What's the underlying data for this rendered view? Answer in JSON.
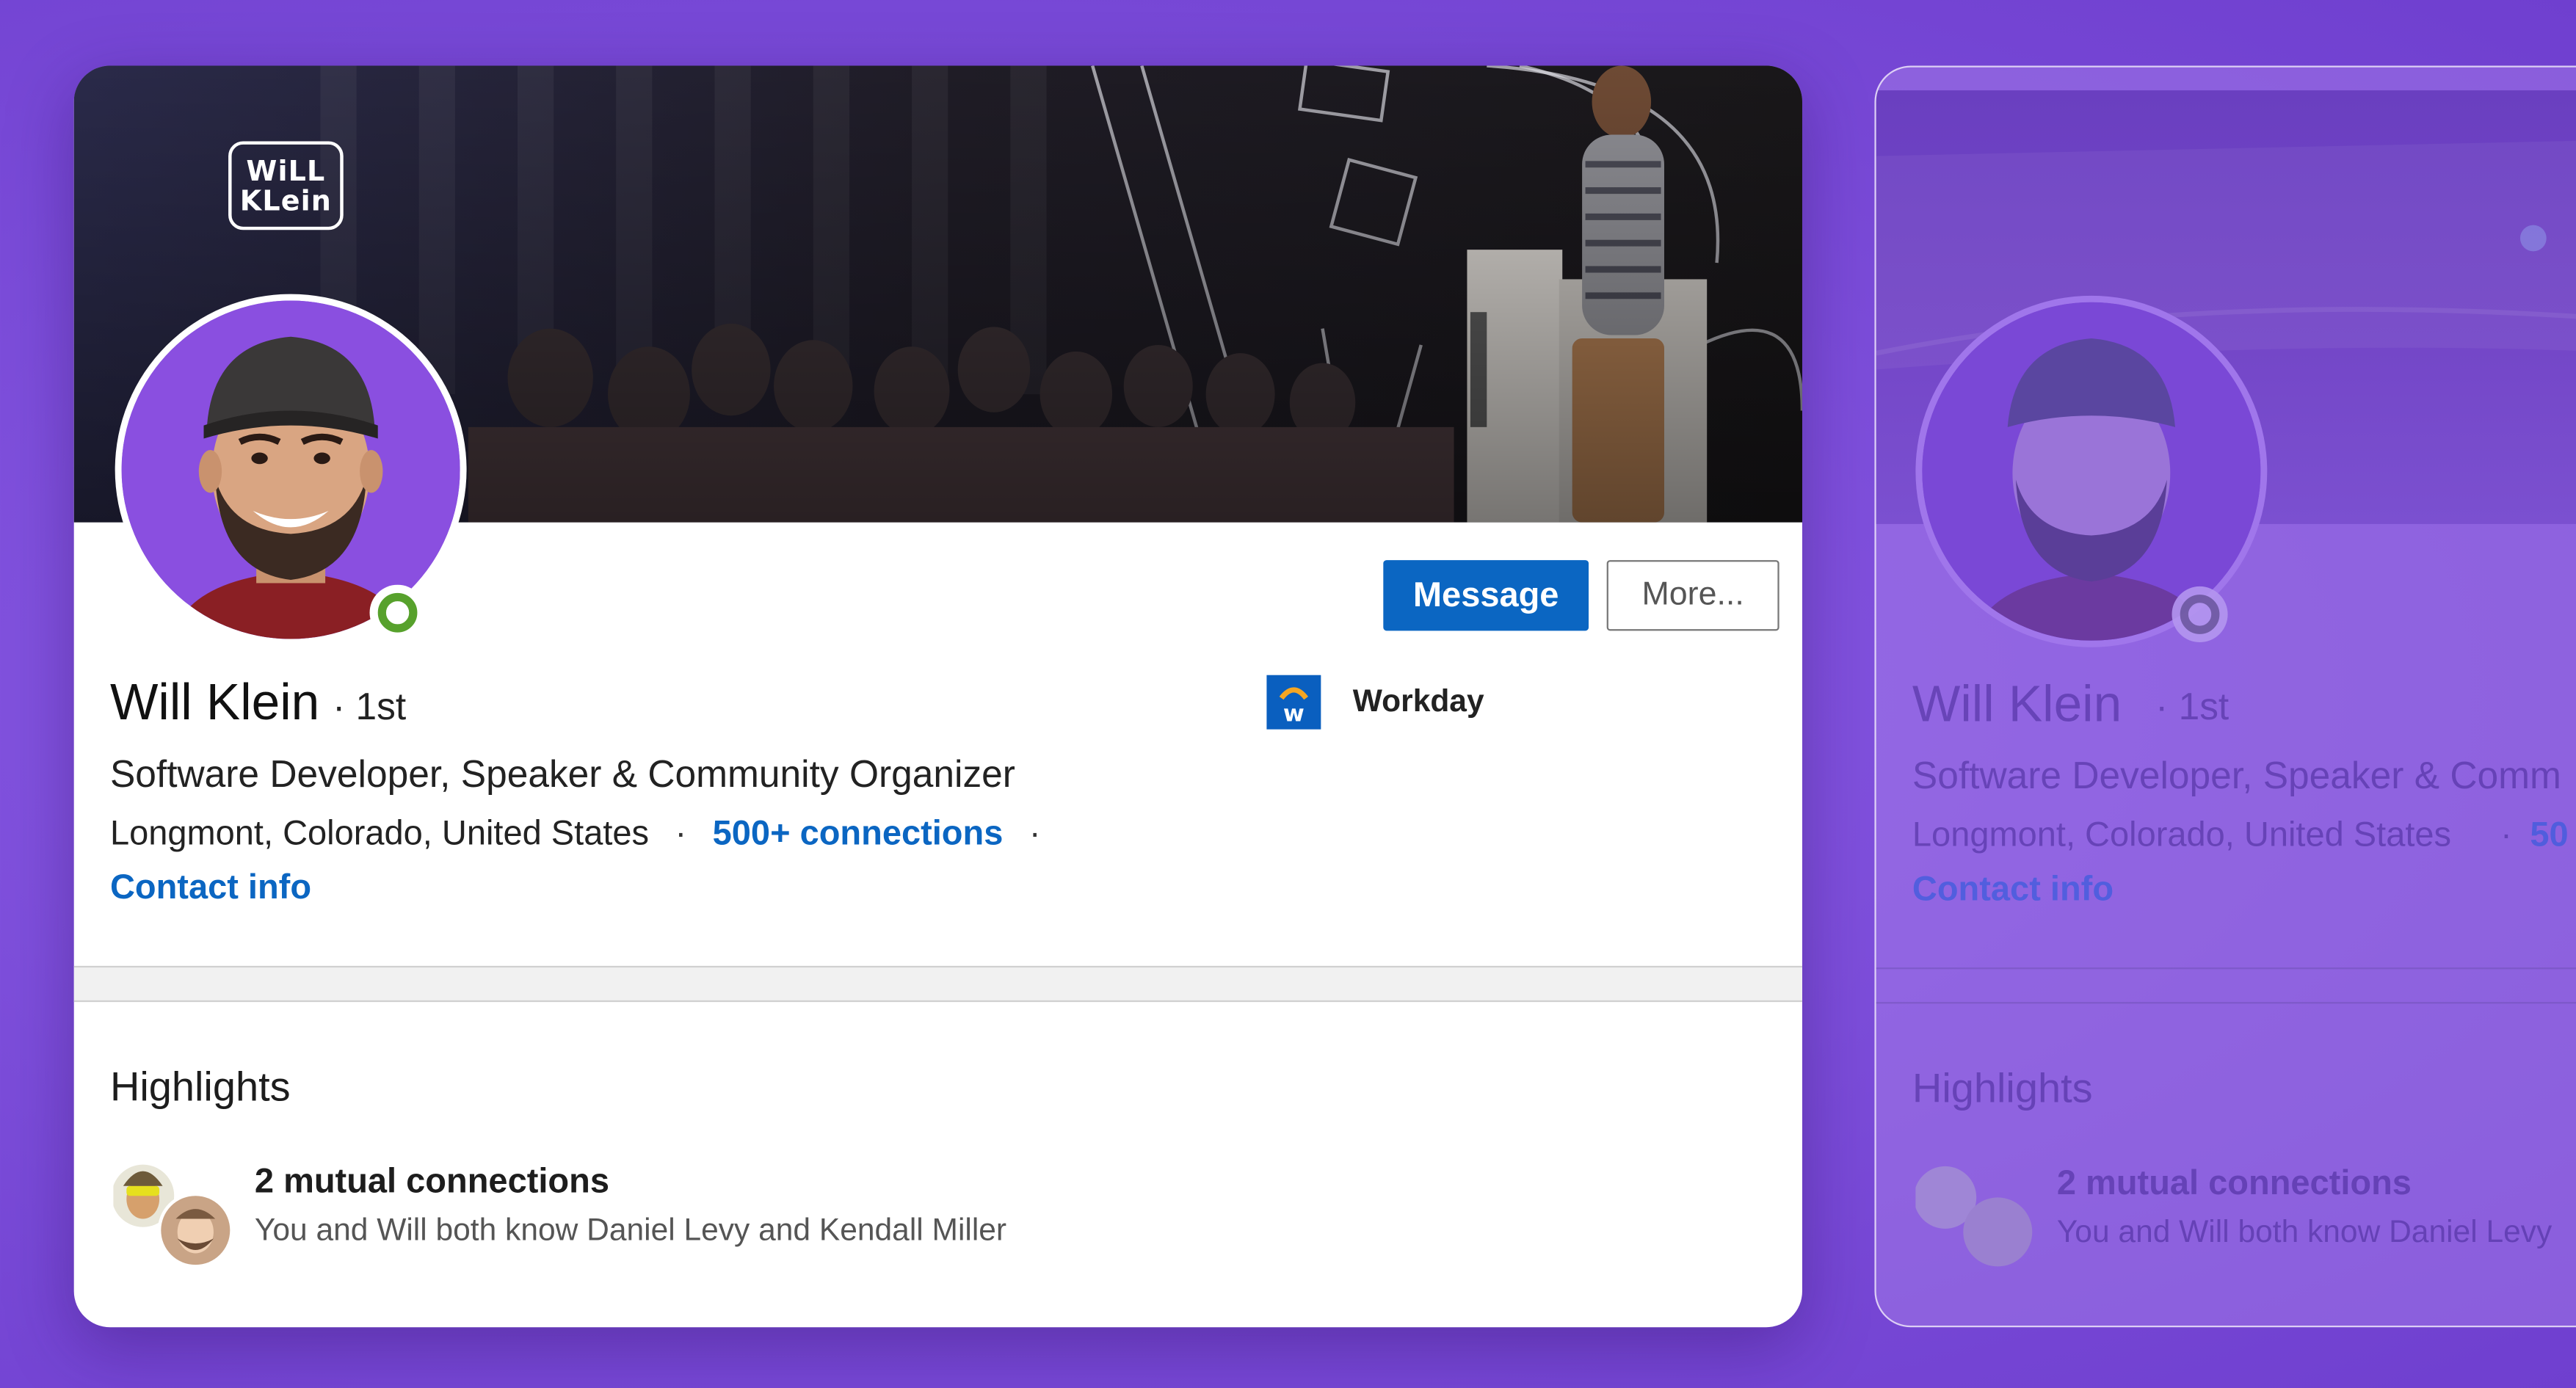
{
  "profile": {
    "logo_line1": "WiLL",
    "logo_line2": "KLein",
    "name": "Will Klein",
    "degree": "· 1st",
    "headline": "Software Developer, Speaker & Community Organizer",
    "location": "Longmont, Colorado, United States",
    "separator": "·",
    "connections": "500+ connections",
    "contact_info": "Contact info"
  },
  "actions": {
    "message_label": "Message",
    "more_label": "More..."
  },
  "company": {
    "logo_letter": "w",
    "name": "Workday",
    "brand_color": "#0a5fbf"
  },
  "highlights": {
    "title": "Highlights",
    "mutual_title": "2 mutual connections",
    "mutual_subtitle": "You and Will both know Daniel Levy and Kendall Miller"
  },
  "ghost": {
    "name": "Will Klein",
    "degree": "· 1st",
    "headline": "Software Developer, Speaker & Comm",
    "location": "Longmont, Colorado, United States",
    "connections": "50",
    "contact_info": "Contact info",
    "highlights_title": "Highlights",
    "mutual_title": "2 mutual connections",
    "mutual_subtitle": "You and Will both know Daniel Levy"
  },
  "colors": {
    "background": "#7e4fdc",
    "link": "#0b66c2",
    "online": "#57a12c",
    "avatar_bg": "#8a4fe0"
  }
}
